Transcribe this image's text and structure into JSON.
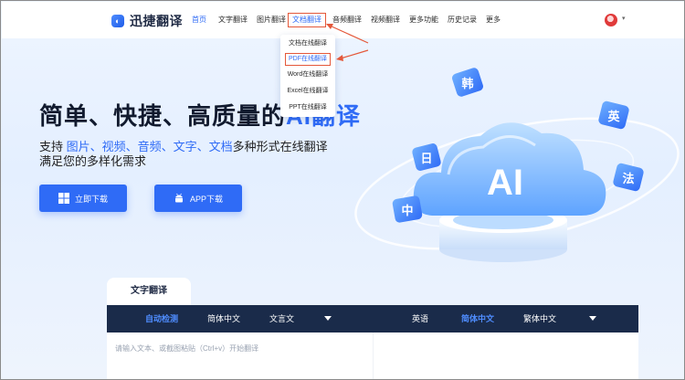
{
  "header": {
    "logo_text": "迅捷翻译",
    "nav": [
      "首页",
      "文字翻译",
      "图片翻译",
      "文档翻译",
      "音频翻译",
      "视频翻译",
      "更多功能",
      "历史记录",
      "更多"
    ]
  },
  "dropdown": {
    "items": [
      "文档在线翻译",
      "PDF在线翻译",
      "Word在线翻译",
      "Excel在线翻译",
      "PPT在线翻译"
    ]
  },
  "hero": {
    "title_main": "简单、快捷、高质量的",
    "title_ai": "AI翻译",
    "sub_prefix": "支持 ",
    "sub_highlight": "图片、视频、音频、文字、文档",
    "sub_suffix": "多种形式在线翻译",
    "sub_line2": "满足您的多样化需求"
  },
  "buttons": {
    "win_download": "立即下载",
    "app_download": "APP下载"
  },
  "illustration": {
    "cloud_text": "AI",
    "bubbles": [
      "韩",
      "英",
      "日",
      "法",
      "中"
    ]
  },
  "translate": {
    "tab_label": "文字翻译",
    "source_langs": [
      "自动检测",
      "简体中文",
      "文言文"
    ],
    "target_langs": [
      "英语",
      "简体中文",
      "繁体中文"
    ],
    "input_placeholder": "请输入文本、或截图粘贴（Ctrl+v）开始翻译"
  },
  "colors": {
    "accent": "#2f6bf6",
    "highlight_outline": "#e4583a",
    "panel_bar": "#1a2b4a"
  }
}
